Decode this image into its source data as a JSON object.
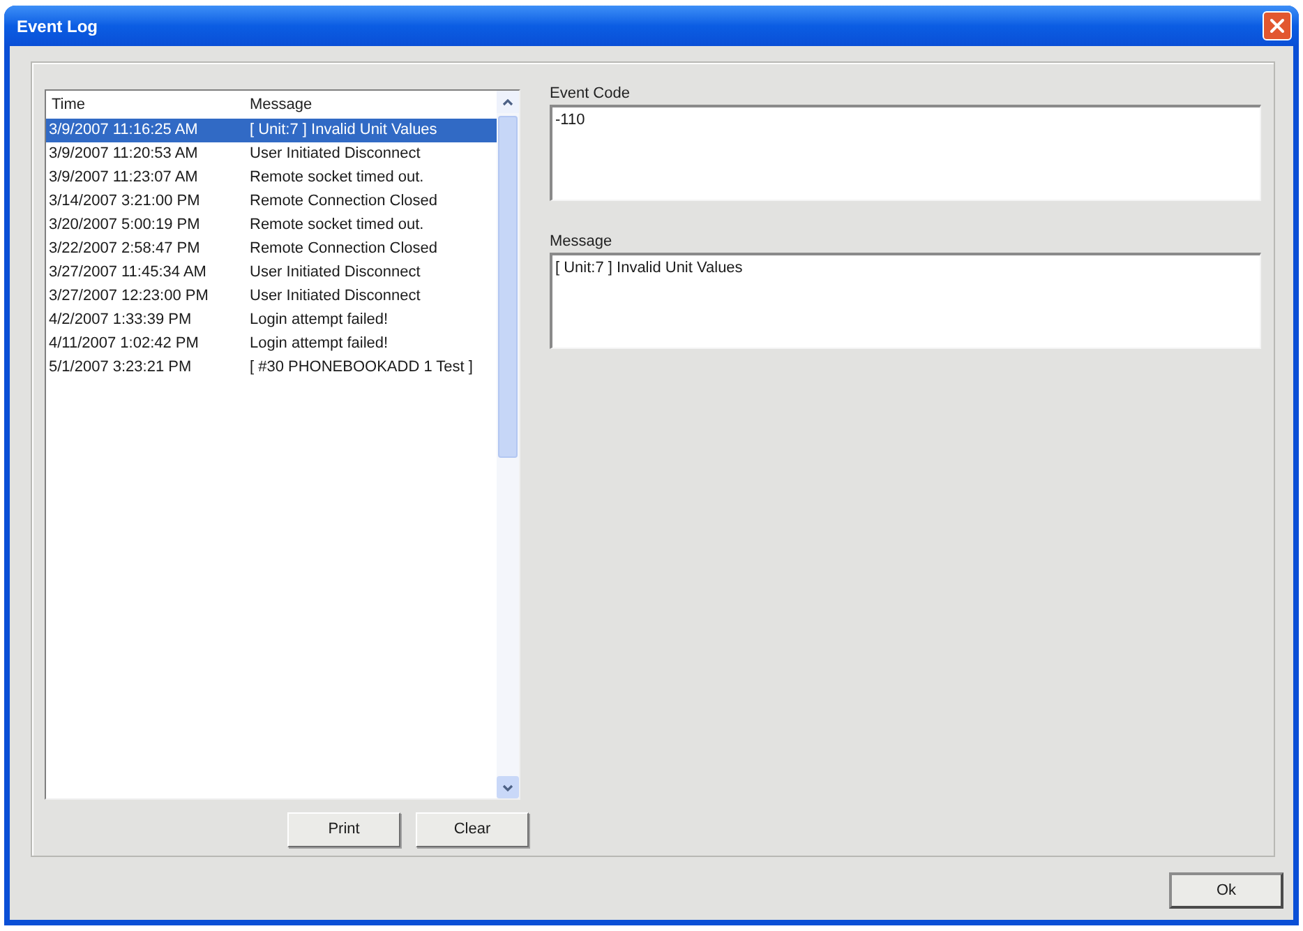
{
  "window": {
    "title": "Event Log"
  },
  "event_list": {
    "columns": [
      "Time",
      "Message"
    ],
    "rows": [
      {
        "time": "3/9/2007 11:16:25 AM",
        "message": "[ Unit:7 ] Invalid Unit Values",
        "selected": true
      },
      {
        "time": "3/9/2007 11:20:53 AM",
        "message": "User Initiated Disconnect",
        "selected": false
      },
      {
        "time": "3/9/2007 11:23:07 AM",
        "message": "Remote socket timed out.",
        "selected": false
      },
      {
        "time": "3/14/2007 3:21:00 PM",
        "message": "Remote Connection Closed",
        "selected": false
      },
      {
        "time": "3/20/2007 5:00:19 PM",
        "message": "Remote socket timed out.",
        "selected": false
      },
      {
        "time": "3/22/2007 2:58:47 PM",
        "message": "Remote Connection Closed",
        "selected": false
      },
      {
        "time": "3/27/2007 11:45:34 AM",
        "message": "User Initiated Disconnect",
        "selected": false
      },
      {
        "time": "3/27/2007 12:23:00 PM",
        "message": "User Initiated Disconnect",
        "selected": false
      },
      {
        "time": "4/2/2007 1:33:39 PM",
        "message": "Login attempt failed!",
        "selected": false
      },
      {
        "time": "4/11/2007 1:02:42 PM",
        "message": "Login attempt failed!",
        "selected": false
      },
      {
        "time": "5/1/2007 3:23:21 PM",
        "message": "[ #30 PHONEBOOKADD 1 Test ]",
        "selected": false
      }
    ]
  },
  "list_buttons": [
    {
      "label": "Print"
    },
    {
      "label": "Clear"
    }
  ],
  "event_code": {
    "label": "Event Code",
    "value": "-110"
  },
  "message": {
    "label": "Message",
    "value": "[ Unit:7 ] Invalid Unit Values"
  },
  "ok_button": {
    "label": "Ok"
  }
}
